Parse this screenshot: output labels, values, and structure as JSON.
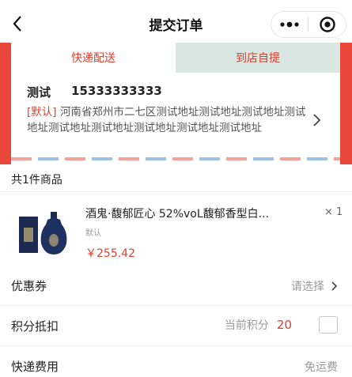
{
  "nav": {
    "title": "提交订单",
    "back_icon": "back-chevron-icon",
    "more_icon": "more-dots-icon",
    "close_icon": "target-close-icon"
  },
  "delivery_tabs": [
    {
      "label": "快递配送",
      "active": true
    },
    {
      "label": "到店自提",
      "active": false
    }
  ],
  "address": {
    "name": "测试",
    "phone": "15333333333",
    "default_tag": "[默认]",
    "text": "河南省郑州市二七区测试地址测试地址测试地址测试地址测试地址测试地址测试地址测试地址测试地址"
  },
  "goods": {
    "count_label": "共1件商品",
    "items": [
      {
        "name": "酒鬼·馥郁匠心 52%voL馥郁香型白...",
        "spec": "默认",
        "price": "￥255.42",
        "qty": "× 1"
      }
    ]
  },
  "coupon": {
    "label": "优惠券",
    "value": "请选择"
  },
  "points": {
    "label": "积分抵扣",
    "prefix": "当前积分",
    "value": "20",
    "checked": false
  },
  "shipping": {
    "label": "快递费用",
    "value": "免运费"
  },
  "colors": {
    "accent": "#d8402f",
    "header_red": "#e9473c",
    "tab_inactive": "#d9e7e3"
  }
}
